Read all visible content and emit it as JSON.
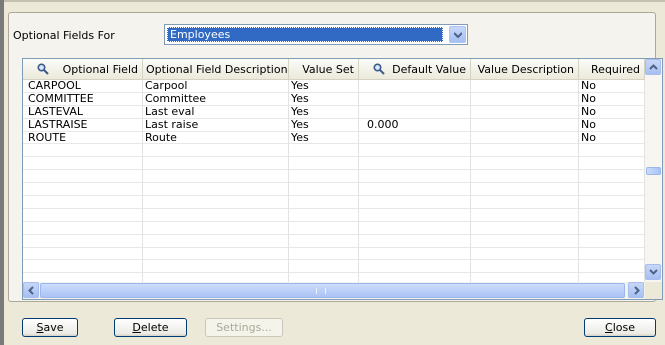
{
  "optional_fields_for": {
    "label": "Optional Fields For",
    "value": "Employees"
  },
  "grid": {
    "columns": [
      {
        "label": "Optional Field",
        "search": true
      },
      {
        "label": "Optional Field Description",
        "search": false
      },
      {
        "label": "Value Set",
        "search": false
      },
      {
        "label": "Default Value",
        "search": true
      },
      {
        "label": "Value Description",
        "search": false
      },
      {
        "label": "Required",
        "search": false
      }
    ],
    "rows": [
      [
        "CARPOOL",
        "Carpool",
        "Yes",
        "",
        "",
        "No"
      ],
      [
        "COMMITTEE",
        "Committee",
        "Yes",
        "",
        "",
        "No"
      ],
      [
        "LASTEVAL",
        "Last eval",
        "Yes",
        "",
        "",
        "No"
      ],
      [
        "LASTRAISE",
        "Last raise",
        "Yes",
        "0.000",
        "",
        "No"
      ],
      [
        "ROUTE",
        "Route",
        "Yes",
        "",
        "",
        "No"
      ]
    ],
    "empty_rows": 11
  },
  "buttons": {
    "save": {
      "mnemonic": "S",
      "rest": "ave"
    },
    "delete": {
      "mnemonic": "D",
      "rest": "elete"
    },
    "settings": "Settings...",
    "close": {
      "mnemonic": "C",
      "rest": "lose"
    }
  },
  "icons": {
    "search": "magnifier-icon",
    "combo": "chevron-down-icon"
  }
}
